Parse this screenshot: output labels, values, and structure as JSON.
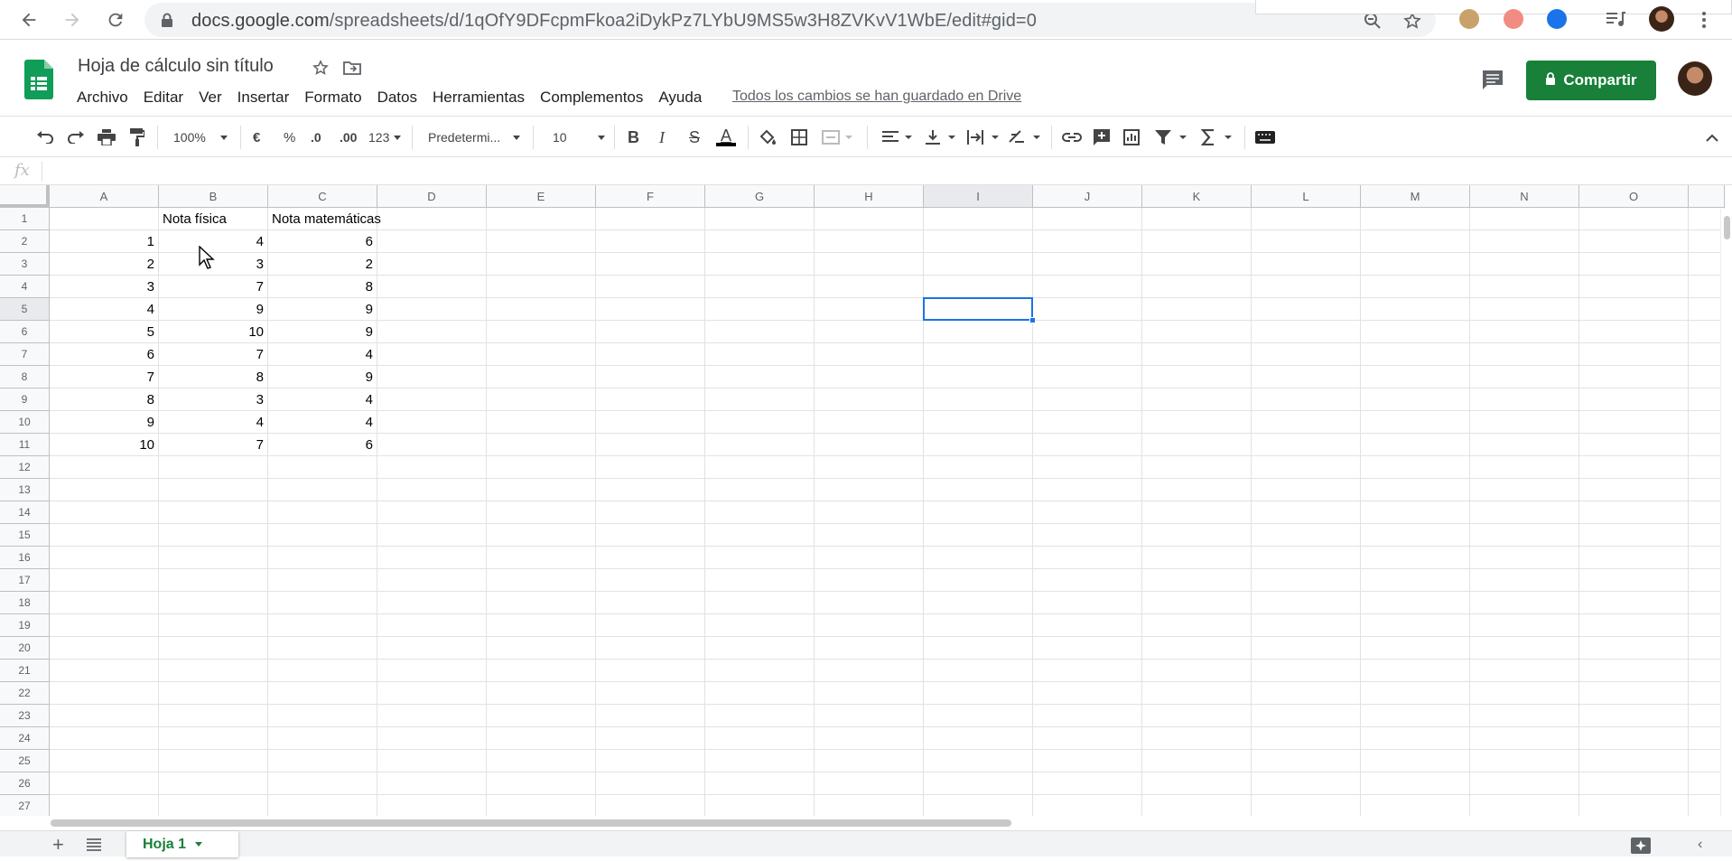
{
  "browser": {
    "url_host": "docs.google.com",
    "url_path": "/spreadsheets/d/1qOfY9DFcpmFkoa2iDykPz7LYbU9MS5w3H8ZVKvV1WbE/edit#gid=0"
  },
  "header": {
    "title": "Hoja de cálculo sin título",
    "menu": [
      "Archivo",
      "Editar",
      "Ver",
      "Insertar",
      "Formato",
      "Datos",
      "Herramientas",
      "Complementos",
      "Ayuda"
    ],
    "save_status": "Todos los cambios se han guardado en Drive",
    "share_label": "Compartir"
  },
  "toolbar": {
    "zoom": "100%",
    "currency": "€",
    "percent": "%",
    "dec_decrease": ".0",
    "dec_increase": ".00",
    "more_formats": "123",
    "font": "Predetermi...",
    "font_size": "10",
    "bold": "B",
    "italic": "I",
    "strike": "S",
    "text_color": "A"
  },
  "formula_bar": {
    "fx": "fx",
    "value": ""
  },
  "grid": {
    "columns": [
      "A",
      "B",
      "C",
      "D",
      "E",
      "F",
      "G",
      "H",
      "I",
      "J",
      "K",
      "L",
      "M",
      "N",
      "O"
    ],
    "rows": [
      "1",
      "2",
      "3",
      "4",
      "5",
      "6",
      "7",
      "8",
      "9",
      "10",
      "11",
      "12",
      "13",
      "14",
      "15",
      "16",
      "17",
      "18",
      "19",
      "20",
      "21",
      "22",
      "23",
      "24",
      "25",
      "26",
      "27"
    ],
    "active_cell": "I5",
    "cells": {
      "B1": "Nota física",
      "C1": "Nota matemáticas",
      "A2": "1",
      "B2": "4",
      "C2": "6",
      "A3": "2",
      "B3": "3",
      "C3": "2",
      "A4": "3",
      "B4": "7",
      "C4": "8",
      "A5": "4",
      "B5": "9",
      "C5": "9",
      "A6": "5",
      "B6": "10",
      "C6": "9",
      "A7": "6",
      "B7": "7",
      "C7": "4",
      "A8": "7",
      "B8": "8",
      "C8": "9",
      "A9": "8",
      "B9": "3",
      "C9": "4",
      "A10": "9",
      "B10": "4",
      "C10": "4",
      "A11": "10",
      "B11": "7",
      "C11": "6"
    }
  },
  "sheets": {
    "tabs": [
      "Hoja 1"
    ],
    "active": "Hoja 1"
  },
  "colors": {
    "brand_green": "#188038",
    "selection_blue": "#1a73e8"
  }
}
